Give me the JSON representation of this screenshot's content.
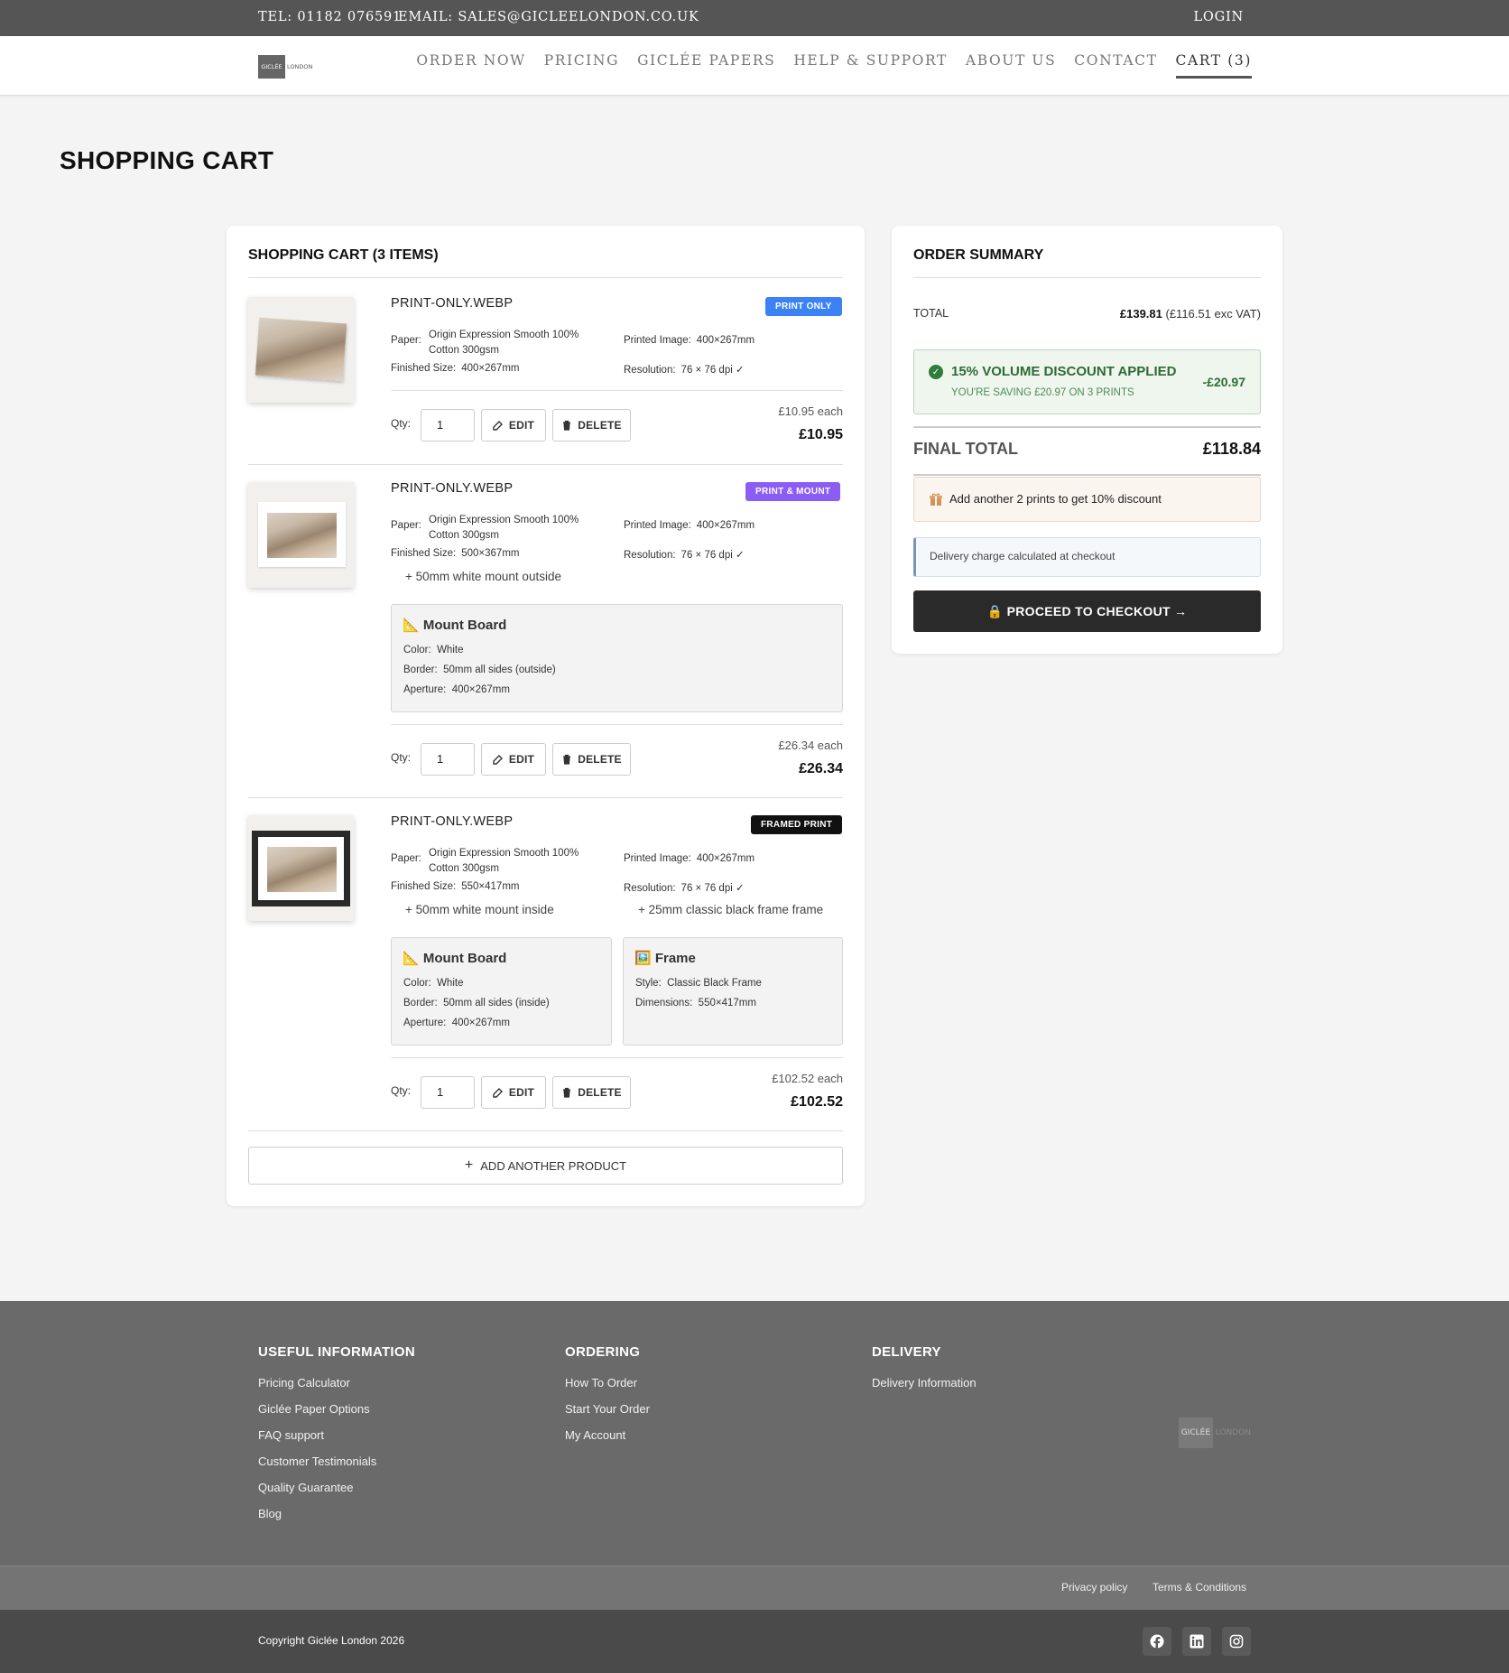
{
  "topbar": {
    "tel": "TEL: 01182 076591",
    "email": "EMAIL: SALES@GICLEELONDON.CO.UK",
    "login": "LOGIN"
  },
  "logo": {
    "box": "GICLÉE",
    "text": "LONDON"
  },
  "nav": [
    "ORDER NOW",
    "PRICING",
    "GICLÉE PAPERS",
    "HELP & SUPPORT",
    "ABOUT US",
    "CONTACT",
    "CART (3)"
  ],
  "page_title": "SHOPPING CART",
  "cart": {
    "title": "SHOPPING CART (3 ITEMS)",
    "qty_label": "Qty:",
    "edit_label": "EDIT",
    "delete_label": "DELETE",
    "add_another": "ADD ANOTHER PRODUCT",
    "items": [
      {
        "name": "PRINT-ONLY.WEBP",
        "badge": "PRINT ONLY",
        "badge_color": "#3b82f6",
        "paper_label": "Paper:",
        "paper_line1": "Origin Expression Smooth 100%",
        "paper_line2": "Cotton 300gsm",
        "printed_label": "Printed Image:",
        "printed": "400×267mm",
        "finished_label": "Finished Size:",
        "finished": "400×267mm",
        "res_label": "Resolution:",
        "res": "76 × 76 dpi ✓",
        "qty": "1",
        "each": "£10.95 each",
        "total": "£10.95"
      },
      {
        "name": "PRINT-ONLY.WEBP",
        "badge": "PRINT & MOUNT",
        "badge_color": "#8b5cf6",
        "paper_label": "Paper:",
        "paper_line1": "Origin Expression Smooth 100%",
        "paper_line2": "Cotton 300gsm",
        "printed_label": "Printed Image:",
        "printed": "400×267mm",
        "finished_label": "Finished Size:",
        "finished": "500×367mm",
        "res_label": "Resolution:",
        "res": "76 × 76 dpi ✓",
        "note": "+ 50mm white mount outside",
        "mount": {
          "title": "📐 Mount Board",
          "color_label": "Color:",
          "color": "White",
          "border_label": "Border:",
          "border": "50mm all sides (outside)",
          "aperture_label": "Aperture:",
          "aperture": "400×267mm"
        },
        "qty": "1",
        "each": "£26.34 each",
        "total": "£26.34"
      },
      {
        "name": "PRINT-ONLY.WEBP",
        "badge": "FRAMED PRINT",
        "badge_color": "#111111",
        "paper_label": "Paper:",
        "paper_line1": "Origin Expression Smooth 100%",
        "paper_line2": "Cotton 300gsm",
        "printed_label": "Printed Image:",
        "printed": "400×267mm",
        "finished_label": "Finished Size:",
        "finished": "550×417mm",
        "res_label": "Resolution:",
        "res": "76 × 76 dpi ✓",
        "note": "+ 50mm white mount inside",
        "note2": "+ 25mm classic black frame frame",
        "mount": {
          "title": "📐 Mount Board",
          "color_label": "Color:",
          "color": "White",
          "border_label": "Border:",
          "border": "50mm all sides (inside)",
          "aperture_label": "Aperture:",
          "aperture": "400×267mm"
        },
        "frame": {
          "title": "🖼️ Frame",
          "style_label": "Style:",
          "style": "Classic Black Frame",
          "dim_label": "Dimensions:",
          "dim": "550×417mm"
        },
        "qty": "1",
        "each": "£102.52 each",
        "total": "£102.52"
      }
    ]
  },
  "summary": {
    "title": "ORDER SUMMARY",
    "total_label": "TOTAL",
    "total": "£139.81",
    "total_ex": "(£116.51 exc VAT)",
    "discount_title": "15% VOLUME DISCOUNT APPLIED",
    "discount_sub": "YOU'RE SAVING £20.97 ON 3 PRINTS",
    "discount_amount": "-£20.97",
    "final_label": "FINAL TOTAL",
    "final": "£118.84",
    "promo": "Add another 2 prints to get 10% discount",
    "delivery": "Delivery charge calculated at checkout",
    "checkout": "🔒 PROCEED TO CHECKOUT →"
  },
  "footer": {
    "useful": {
      "title": "USEFUL INFORMATION",
      "links": [
        "Pricing Calculator",
        "Giclée Paper Options",
        "FAQ support",
        "Customer Testimonials",
        "Quality Guarantee",
        "Blog"
      ]
    },
    "ordering": {
      "title": "ORDERING",
      "links": [
        "How To Order",
        "Start Your Order",
        "My Account"
      ]
    },
    "delivery": {
      "title": "DELIVERY",
      "links": [
        "Delivery Information"
      ]
    },
    "privacy": "Privacy policy",
    "terms": "Terms & Conditions",
    "copyright": "Copyright Giclée London 2026",
    "social_icons": [
      "facebook-icon",
      "linkedin-icon",
      "instagram-icon"
    ]
  }
}
